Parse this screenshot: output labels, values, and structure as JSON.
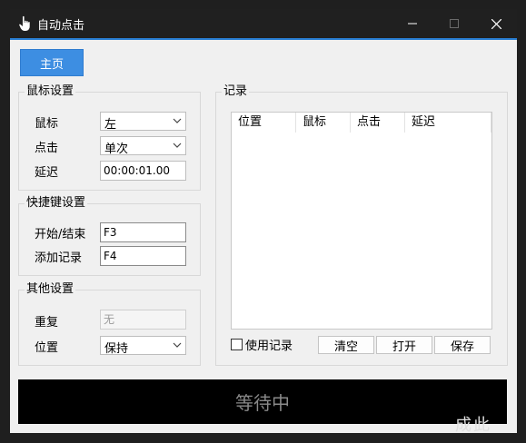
{
  "window": {
    "title": "自动点击"
  },
  "toolbar": {
    "home_label": "主页"
  },
  "mouse_settings": {
    "title": "鼠标设置",
    "button_label": "鼠标",
    "button_value": "左",
    "click_label": "点击",
    "click_value": "单次",
    "delay_label": "延迟",
    "delay_value": "00:00:01.00"
  },
  "hotkey_settings": {
    "title": "快捷键设置",
    "start_stop_label": "开始/结束",
    "start_stop_value": "F3",
    "add_record_label": "添加记录",
    "add_record_value": "F4"
  },
  "other_settings": {
    "title": "其他设置",
    "repeat_label": "重复",
    "repeat_value": "无",
    "position_label": "位置",
    "position_value": "保持"
  },
  "records": {
    "title": "记录",
    "columns": [
      "位置",
      "鼠标",
      "点击",
      "延迟"
    ],
    "rows": [],
    "use_records_label": "使用记录",
    "use_records_checked": false,
    "clear_label": "清空",
    "open_label": "打开",
    "save_label": "保存"
  },
  "status": {
    "text": "等待中"
  },
  "overlay": {
    "text": "成此"
  },
  "colors": {
    "accent": "#2a7fd4",
    "home_button": "#3d8ee2",
    "status_bg": "#000000"
  }
}
